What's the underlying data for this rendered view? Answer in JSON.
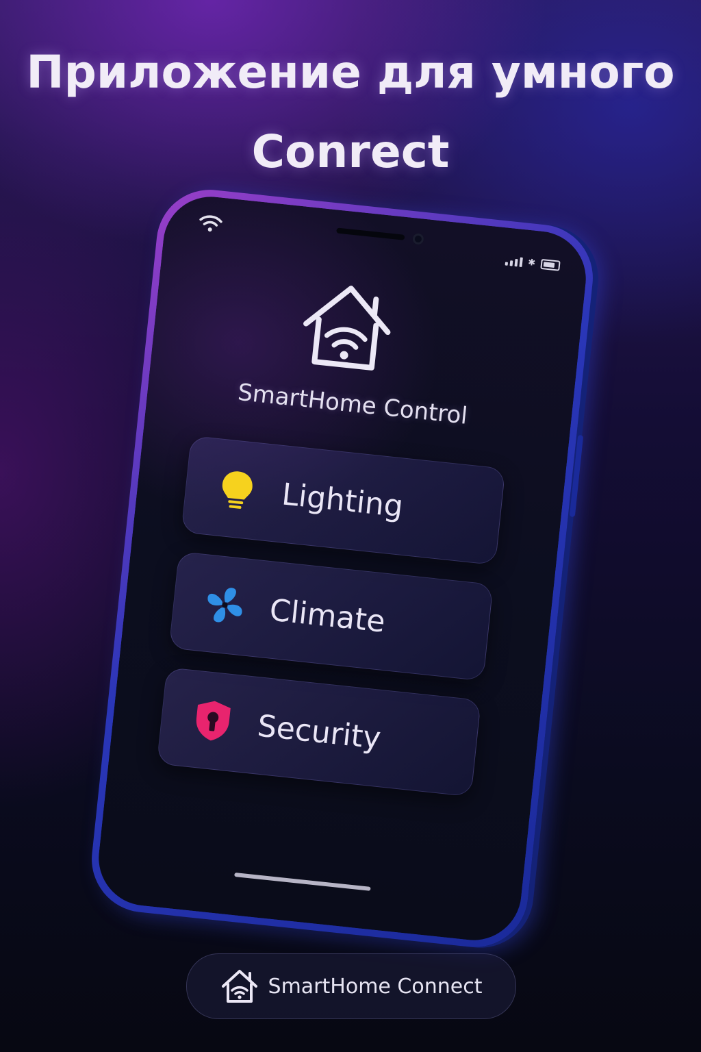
{
  "headline": {
    "line1": "Приложение для умного",
    "line2": "Conrect"
  },
  "phone": {
    "app_title": "SmartHome Control",
    "cards": [
      {
        "label": "Lighting",
        "icon": "lightbulb-icon",
        "color": "#f6d21e"
      },
      {
        "label": "Climate",
        "icon": "fan-icon",
        "color": "#2f8fe6"
      },
      {
        "label": "Security",
        "icon": "shield-lock-icon",
        "color": "#e8246e"
      }
    ]
  },
  "footer": {
    "brand_name": "SmartHome Connect",
    "brand_icon": "house-wifi-icon"
  }
}
